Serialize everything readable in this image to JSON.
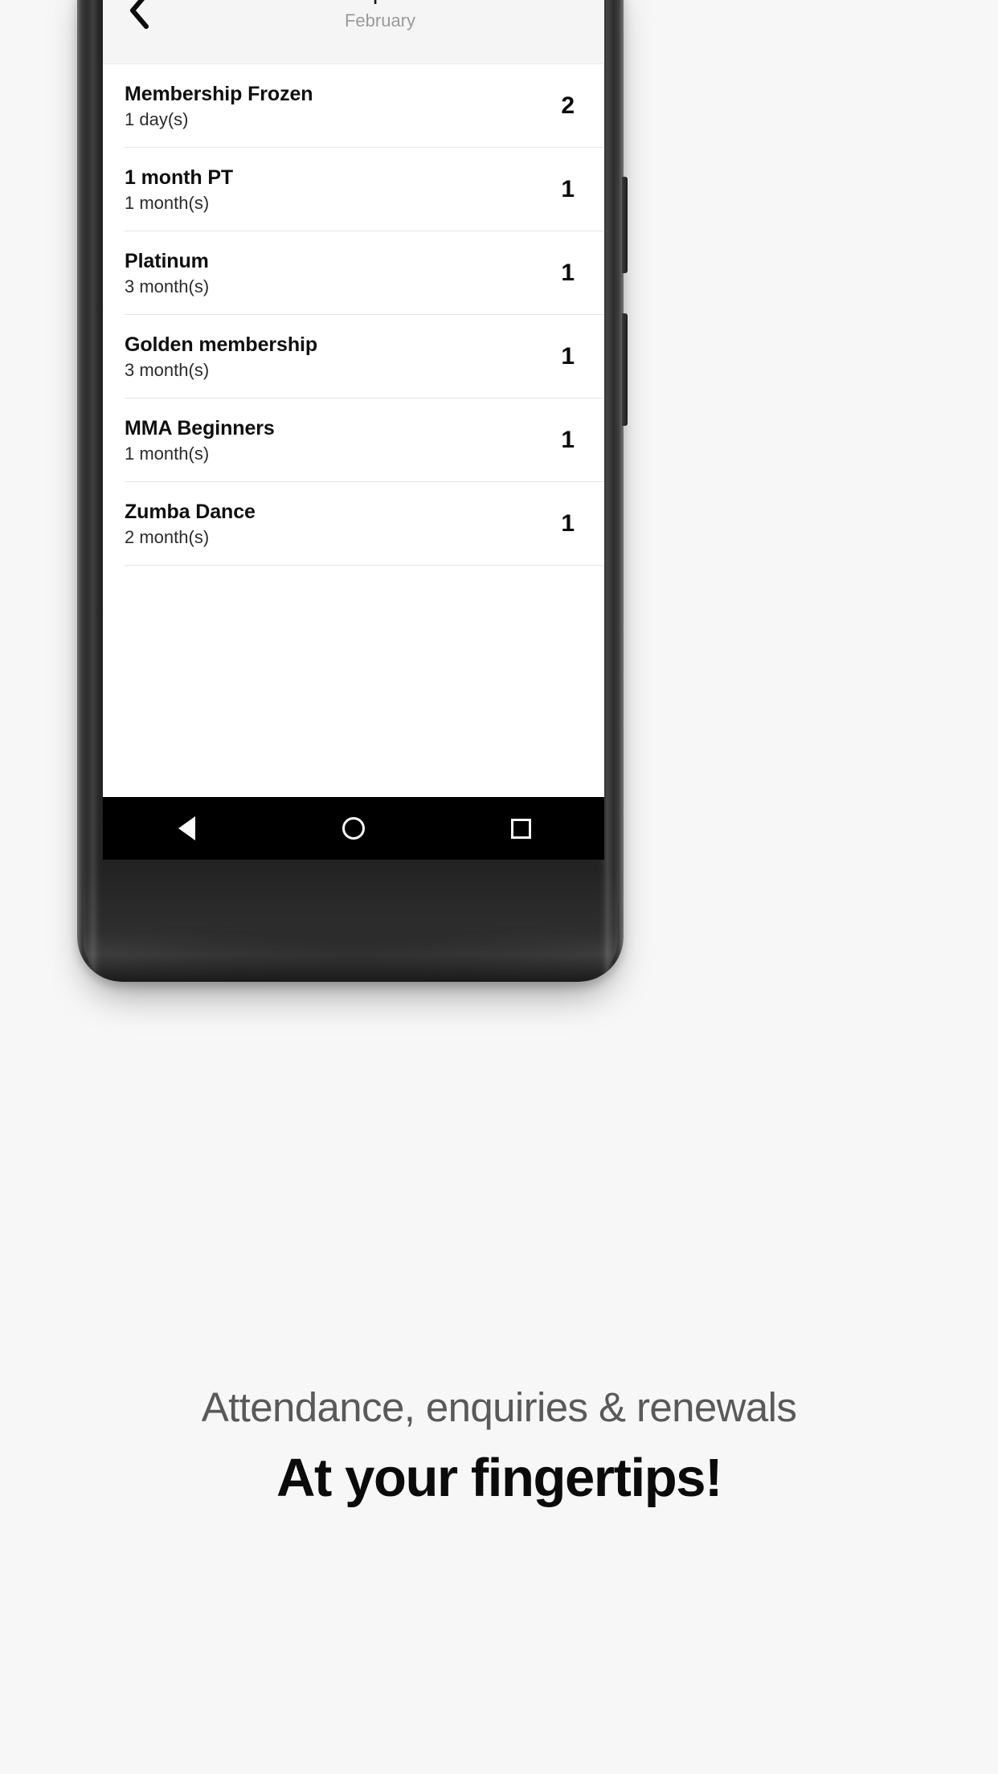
{
  "app": {
    "header": {
      "back_icon": "chevron-left-icon",
      "title": "Memberships Renewed",
      "subtitle": "February"
    },
    "list": {
      "rows": [
        {
          "name": "Membership Frozen",
          "duration": "1 day(s)",
          "count": "2"
        },
        {
          "name": "1 month PT",
          "duration": "1 month(s)",
          "count": "1"
        },
        {
          "name": "Platinum",
          "duration": "3 month(s)",
          "count": "1"
        },
        {
          "name": "Golden membership",
          "duration": "3 month(s)",
          "count": "1"
        },
        {
          "name": "MMA Beginners",
          "duration": "1 month(s)",
          "count": "1"
        },
        {
          "name": "Zumba Dance",
          "duration": "2 month(s)",
          "count": "1"
        }
      ]
    },
    "nav_bar": {
      "back_icon": "triangle-back-icon",
      "home_icon": "circle-home-icon",
      "recents_icon": "square-recents-icon"
    }
  },
  "marketing": {
    "line1": "Attendance, enquiries & renewals",
    "line2": "At your fingertips!"
  },
  "colors": {
    "page_background": "#f7f7f7",
    "header_background": "#f5f5f5",
    "screen_background": "#ffffff",
    "title_text": "#1a1a1a",
    "subtitle_text": "#9b9b9b",
    "row_name_text": "#0f0f0f",
    "row_duration_text": "#2b2b2b",
    "row_count_text": "#0a0a0a",
    "divider": "#e3e3e3",
    "nav_bar_background": "#000000",
    "nav_icon": "#fbfbfb",
    "tagline1_text": "#595959",
    "tagline2_text": "#0b0b0b"
  }
}
